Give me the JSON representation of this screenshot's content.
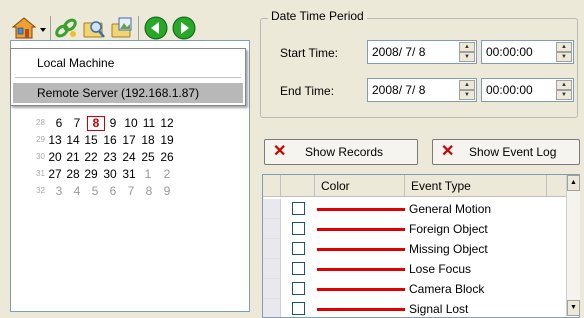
{
  "toolbar": {
    "icons": [
      "home-icon",
      "chevron-down-icon",
      "link-icon",
      "search-folder-icon",
      "image-folder-icon",
      "back-arrow-icon",
      "forward-arrow-icon"
    ]
  },
  "menu": {
    "items": [
      {
        "label": "Local Machine"
      },
      {
        "label": "Remote Server (192.168.1.87)",
        "selected": true
      }
    ]
  },
  "calendar": {
    "weeks": [
      {
        "wk": "28",
        "days": [
          {
            "d": "6"
          },
          {
            "d": "7"
          },
          {
            "d": "8",
            "today": true
          },
          {
            "d": "9"
          },
          {
            "d": "10"
          },
          {
            "d": "11"
          },
          {
            "d": "12"
          }
        ]
      },
      {
        "wk": "29",
        "days": [
          {
            "d": "13"
          },
          {
            "d": "14"
          },
          {
            "d": "15"
          },
          {
            "d": "16"
          },
          {
            "d": "17"
          },
          {
            "d": "18"
          },
          {
            "d": "19"
          }
        ]
      },
      {
        "wk": "30",
        "days": [
          {
            "d": "20"
          },
          {
            "d": "21"
          },
          {
            "d": "22"
          },
          {
            "d": "23"
          },
          {
            "d": "24"
          },
          {
            "d": "25"
          },
          {
            "d": "26"
          }
        ]
      },
      {
        "wk": "31",
        "days": [
          {
            "d": "27"
          },
          {
            "d": "28"
          },
          {
            "d": "29"
          },
          {
            "d": "30"
          },
          {
            "d": "31"
          },
          {
            "d": "1",
            "other": true
          },
          {
            "d": "2",
            "other": true
          }
        ]
      },
      {
        "wk": "32",
        "days": [
          {
            "d": "3",
            "other": true
          },
          {
            "d": "4",
            "other": true
          },
          {
            "d": "5",
            "other": true
          },
          {
            "d": "6",
            "other": true
          },
          {
            "d": "7",
            "other": true
          },
          {
            "d": "8",
            "other": true
          },
          {
            "d": "9",
            "other": true
          }
        ]
      }
    ],
    "today_color": "#cc0000"
  },
  "period": {
    "title": "Date Time Period",
    "start_label": "Start Time:",
    "start_date": "2008/ 7/ 8",
    "start_time": "00:00:00",
    "end_label": "End Time:",
    "end_date": "2008/ 7/ 8",
    "end_time": "00:00:00"
  },
  "buttons": {
    "show_records": "Show Records",
    "show_event_log": "Show Event Log"
  },
  "table": {
    "headers": {
      "color": "Color",
      "event_type": "Event Type"
    },
    "line_color": "#e00000",
    "rows": [
      {
        "event": "General Motion",
        "checked": false
      },
      {
        "event": "Foreign Object",
        "checked": false
      },
      {
        "event": "Missing Object",
        "checked": false
      },
      {
        "event": "Lose Focus",
        "checked": false
      },
      {
        "event": "Camera Block",
        "checked": false
      },
      {
        "event": "Signal Lost",
        "checked": false
      }
    ]
  }
}
